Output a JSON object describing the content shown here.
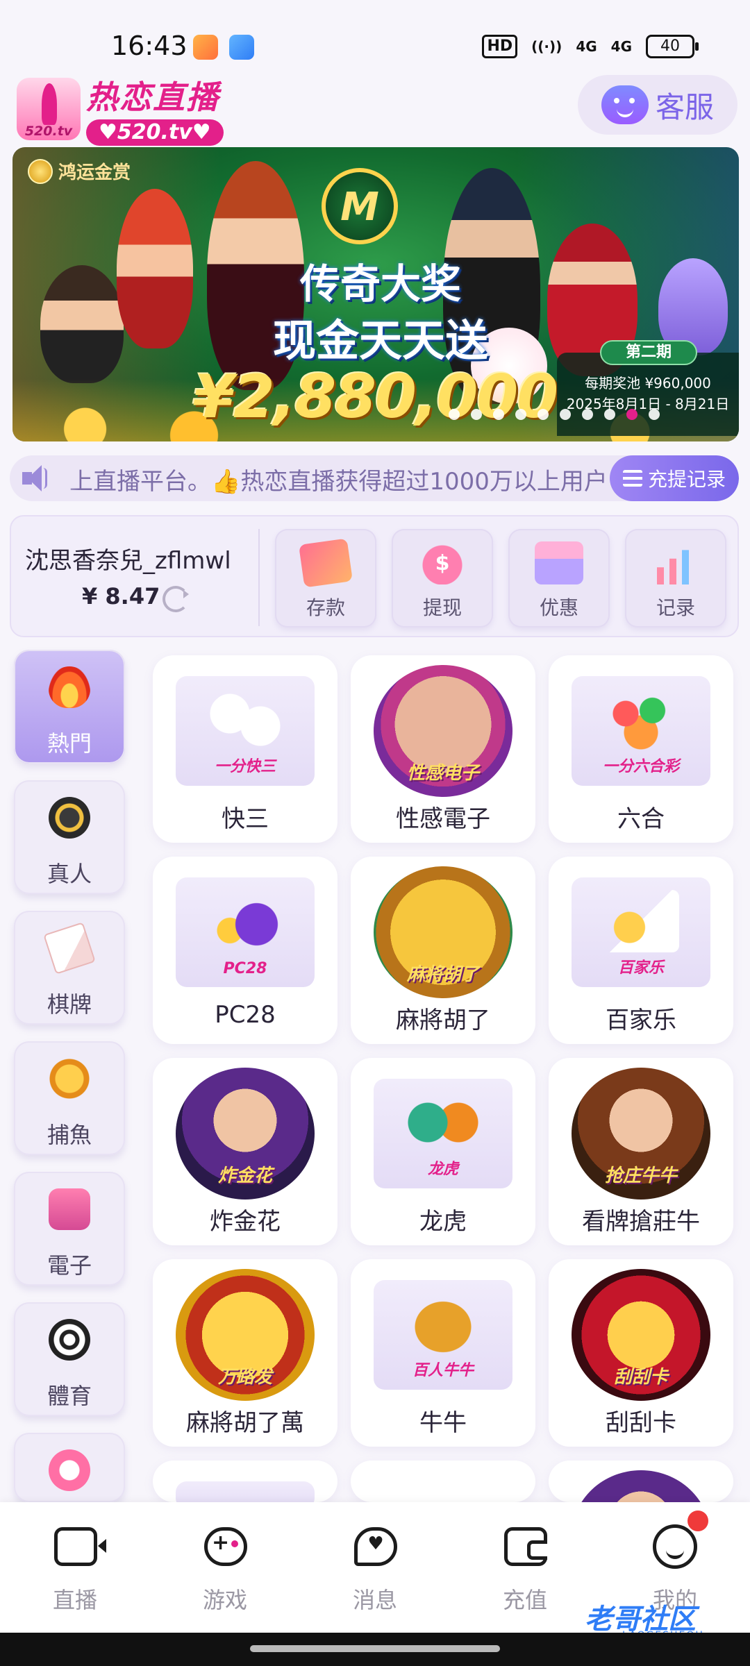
{
  "status_bar": {
    "time": "16:43",
    "hd": "HD",
    "net1": "4G",
    "net2": "4G",
    "battery": "40"
  },
  "header": {
    "logo_title": "热恋直播",
    "logo_sub": "♥520.tv♥",
    "logo_mark_text": "520.tv",
    "service_label": "客服"
  },
  "banner": {
    "brand": "鸿运金赏",
    "title_line1": "传奇大奖",
    "title_line2": "现金天天送",
    "amount": "¥2,880,000",
    "period_tag": "第二期",
    "period_pool": "每期奖池 ¥960,000",
    "period_dates": "2025年8月1日 - 8月21日",
    "slide_count": 10,
    "active_slide": 8
  },
  "marquee": {
    "text": "上直播平台。👍热恋直播获得超过1000万以上用户",
    "records_label": "充提记录"
  },
  "wallet": {
    "username": "沈思香奈兒_zflmwl",
    "balance": "¥ 8.47",
    "actions": [
      {
        "label": "存款",
        "icon": "deposit-icon"
      },
      {
        "label": "提现",
        "icon": "withdraw-icon"
      },
      {
        "label": "优惠",
        "icon": "promo-icon"
      },
      {
        "label": "记录",
        "icon": "record-icon"
      }
    ]
  },
  "categories": [
    {
      "label": "熱門",
      "icon": "fire-icon",
      "active": true
    },
    {
      "label": "真人",
      "icon": "chip-icon"
    },
    {
      "label": "棋牌",
      "icon": "card-icon"
    },
    {
      "label": "捕魚",
      "icon": "fish-icon"
    },
    {
      "label": "電子",
      "icon": "slot-icon"
    },
    {
      "label": "體育",
      "icon": "soccer-ball-icon"
    },
    {
      "label": "",
      "icon": "lottery-icon"
    }
  ],
  "games": [
    {
      "label": "快三",
      "tag": "一分快三"
    },
    {
      "label": "性感電子",
      "tag": "性感电子"
    },
    {
      "label": "六合",
      "tag": "一分六合彩"
    },
    {
      "label": "PC28",
      "tag": "PC28"
    },
    {
      "label": "麻將胡了",
      "tag": "麻将胡了"
    },
    {
      "label": "百家乐",
      "tag": "百家乐"
    },
    {
      "label": "炸金花",
      "tag": "炸金花"
    },
    {
      "label": "龙虎",
      "tag": "龙虎"
    },
    {
      "label": "看牌搶莊牛",
      "tag": "抢庄牛牛"
    },
    {
      "label": "麻將胡了萬",
      "tag": "万路发"
    },
    {
      "label": "牛牛",
      "tag": "百人牛牛"
    },
    {
      "label": "刮刮卡",
      "tag": "刮刮卡"
    }
  ],
  "bottom_nav": [
    {
      "label": "直播",
      "icon": "live-camera-icon"
    },
    {
      "label": "游戏",
      "icon": "gamepad-icon"
    },
    {
      "label": "消息",
      "icon": "message-icon"
    },
    {
      "label": "充值",
      "icon": "wallet-icon"
    },
    {
      "label": "我的",
      "icon": "profile-icon"
    }
  ],
  "watermark": {
    "text": "老哥社区",
    "sub": "LAOGESHEQU"
  }
}
